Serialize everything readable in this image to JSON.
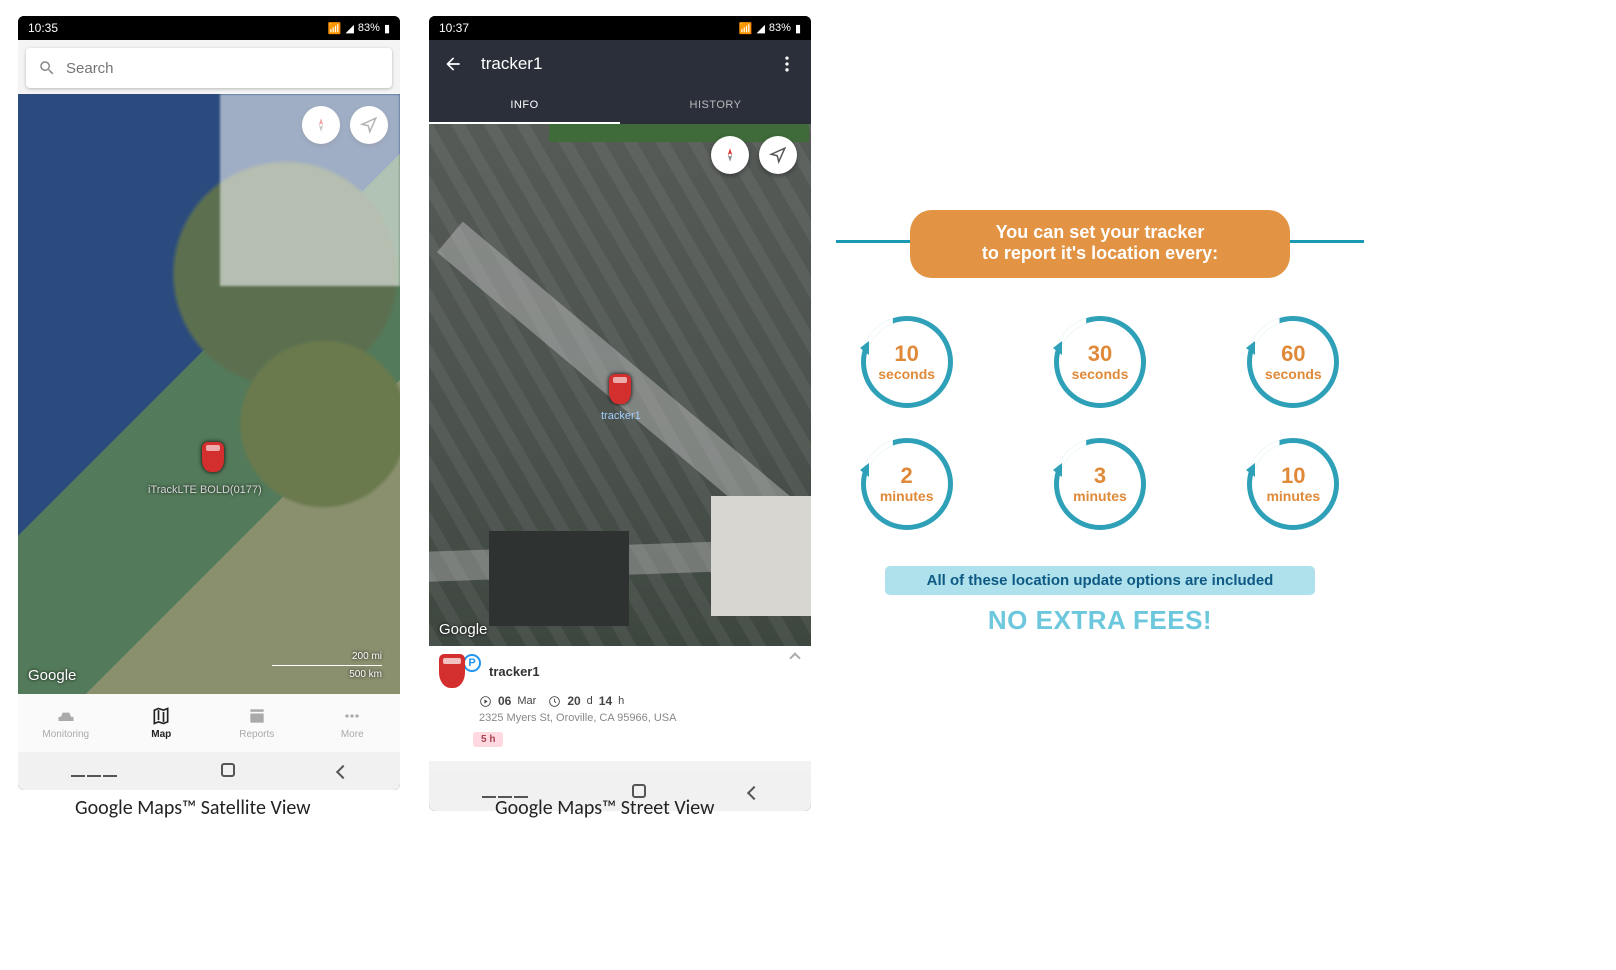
{
  "status": {
    "time_left": "10:35",
    "time_right": "10:37",
    "battery": "83%",
    "battery_icon": "▮",
    "wifi": "📶",
    "signal": "📶"
  },
  "phoneA": {
    "search_placeholder": "Search",
    "product_label": "iTrackLTE BOLD(0177)",
    "scale_top": "200 mi",
    "scale_bottom": "500 km",
    "watermark": "Google",
    "nav": {
      "monitoring": "Monitoring",
      "map": "Map",
      "reports": "Reports",
      "more": "More"
    },
    "caption": "Google Maps™ Satellite View"
  },
  "phoneB": {
    "title": "tracker1",
    "tabs": {
      "info": "INFO",
      "history": "HISTORY"
    },
    "watermark": "Google",
    "marker_label": "tracker1",
    "card": {
      "name": "tracker1",
      "park_badge": "P",
      "date_num": "06",
      "date_mon": "Mar",
      "dur_days": "20",
      "dur_d": "d",
      "dur_hours": "14",
      "dur_h": "h",
      "address": "2325 Myers St, Oroville, CA 95966, USA",
      "pill": "5 h"
    },
    "caption": "Google Maps™ Street View"
  },
  "info": {
    "headline_l1": "You can set your tracker",
    "headline_l2": "to report it's location every:",
    "dials": [
      {
        "num": "10",
        "unit": "seconds"
      },
      {
        "num": "30",
        "unit": "seconds"
      },
      {
        "num": "60",
        "unit": "seconds"
      },
      {
        "num": "2",
        "unit": "minutes"
      },
      {
        "num": "3",
        "unit": "minutes"
      },
      {
        "num": "10",
        "unit": "minutes"
      }
    ],
    "subbanner": "All of these location update options are included",
    "noextra": "NO EXTRA FEES!"
  }
}
